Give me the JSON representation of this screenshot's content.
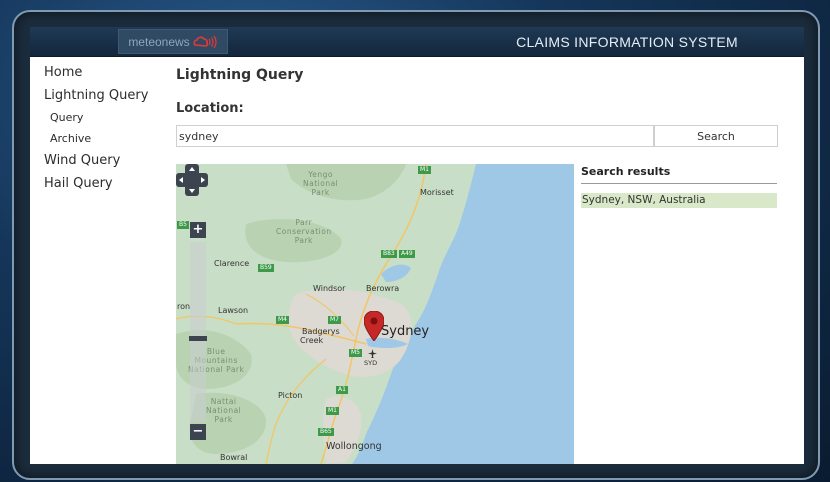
{
  "header": {
    "logo_text": "meteonews",
    "system_title": "CLAIMS INFORMATION SYSTEM"
  },
  "sidebar": {
    "items": [
      {
        "label": "Home"
      },
      {
        "label": "Lightning Query",
        "children": [
          {
            "label": "Query"
          },
          {
            "label": "Archive"
          }
        ]
      },
      {
        "label": "Wind Query"
      },
      {
        "label": "Hail Query"
      }
    ]
  },
  "main": {
    "page_title": "Lightning Query",
    "location_label": "Location:",
    "search_value": "sydney",
    "search_button": "Search"
  },
  "map": {
    "city_label": "Sydney",
    "labels": {
      "clarence": "Clarence",
      "lawson": "Lawson",
      "windsor": "Windsor",
      "berowra": "Berowra",
      "badgerys": "Badgerys",
      "creek": "Creek",
      "morisset": "Morisset",
      "picton": "Picton",
      "wollongong": "Wollongong",
      "bowral": "Bowral",
      "syd": "SYD",
      "ron": "ron"
    },
    "parks": {
      "yengo": [
        "Yengo",
        "National",
        "Park"
      ],
      "parr": [
        "Parr",
        "Conservation",
        "Park"
      ],
      "blue": [
        "Blue",
        "Mountains",
        "National Park"
      ],
      "nattai": [
        "Nattai",
        "National",
        "Park"
      ]
    },
    "shields": {
      "m1_top": "M1",
      "b59": "B59",
      "m4": "M4",
      "m7": "M7",
      "m5": "M5",
      "a1": "A1",
      "m1_lower": "M1",
      "b65": "B65",
      "a49": "A49",
      "b83": "B83",
      "a1_pic": "A1",
      "left_shield": "B5"
    },
    "zoom_in": "+",
    "zoom_out": "−",
    "zoom_level_fraction": 0.52,
    "colors": {
      "water": "#9ec8e6",
      "land": "#c9dec6",
      "urban": "#dcdad2",
      "marker": "#c62828"
    }
  },
  "results": {
    "title": "Search results",
    "items": [
      {
        "label": "Sydney, NSW, Australia"
      }
    ]
  },
  "colors": {
    "header_bg": "#1a334c",
    "result_highlight": "#d8e8c8"
  }
}
